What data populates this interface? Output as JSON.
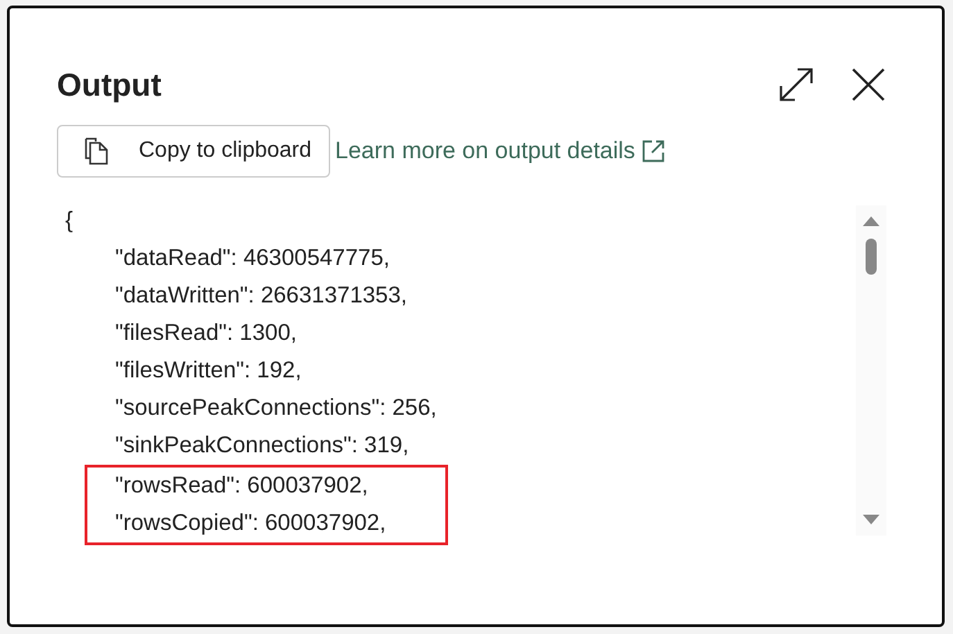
{
  "dialog": {
    "title": "Output",
    "copy_button": "Copy to clipboard",
    "link": "Learn more on output details"
  },
  "output": {
    "open_brace": "{",
    "lines": [
      {
        "text": "\"dataRead\": 46300547775,",
        "highlighted": false
      },
      {
        "text": "\"dataWritten\": 26631371353,",
        "highlighted": false
      },
      {
        "text": "\"filesRead\": 1300,",
        "highlighted": false
      },
      {
        "text": "\"filesWritten\": 192,",
        "highlighted": false
      },
      {
        "text": "\"sourcePeakConnections\": 256,",
        "highlighted": false
      },
      {
        "text": "\"sinkPeakConnections\": 319,",
        "highlighted": false
      },
      {
        "text": "\"rowsRead\": 600037902,",
        "highlighted": true
      },
      {
        "text": "\"rowsCopied\": 600037902,",
        "highlighted": true
      }
    ]
  }
}
